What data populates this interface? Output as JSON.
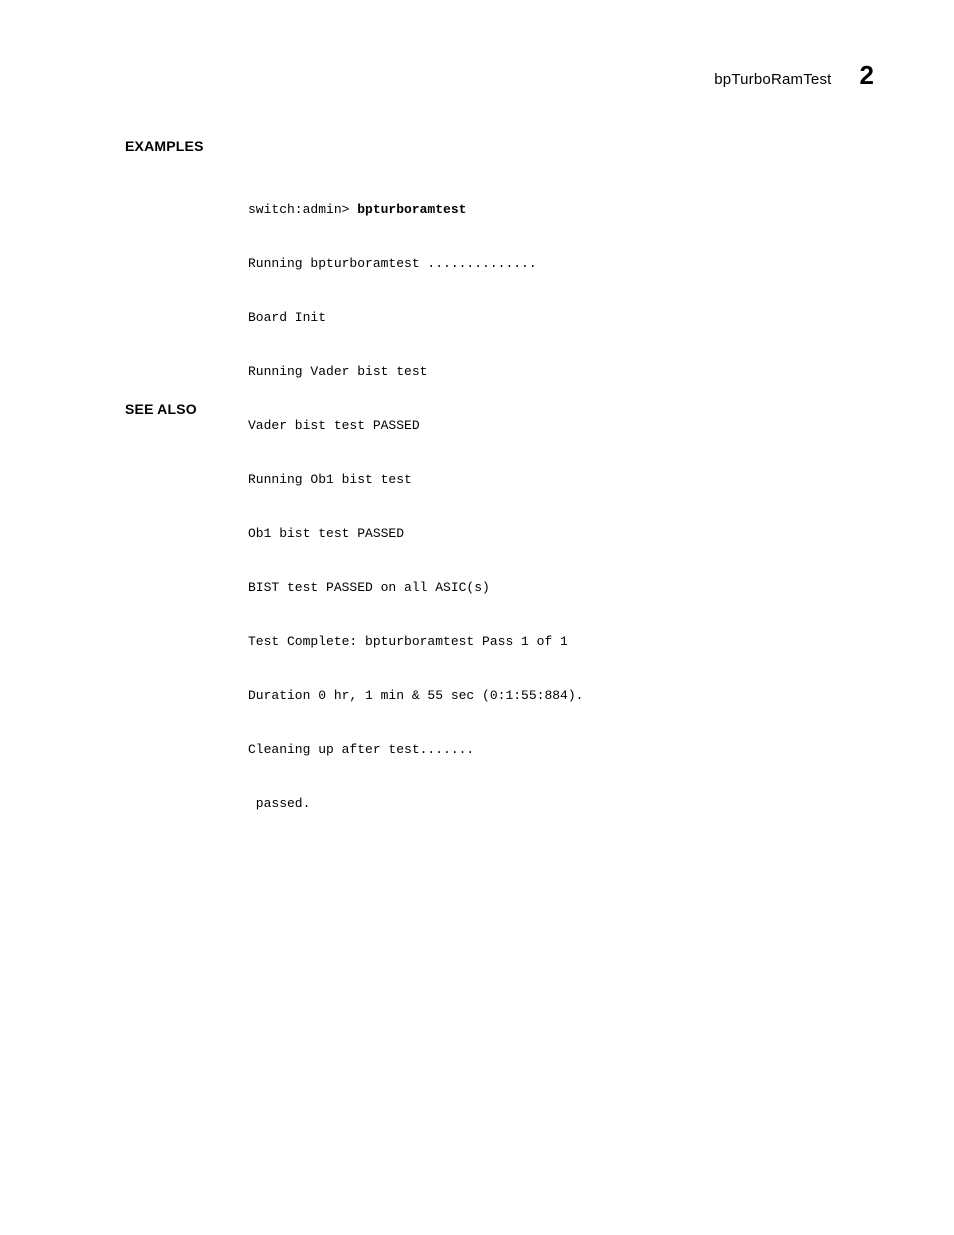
{
  "header": {
    "title": "bpTurboRamTest",
    "chapter_number": "2"
  },
  "sections": {
    "examples_label": "EXAMPLES",
    "see_also_label": "SEE ALSO"
  },
  "code": {
    "prompt": "switch:admin> ",
    "command": "bpturboramtest",
    "lines": [
      "Running bpturboramtest ..............",
      "Board Init",
      "Running Vader bist test",
      "Vader bist test PASSED",
      "Running Ob1 bist test",
      "Ob1 bist test PASSED",
      "BIST test PASSED on all ASIC(s)",
      "Test Complete: bpturboramtest Pass 1 of 1",
      "Duration 0 hr, 1 min & 55 sec (0:1:55:884).",
      "Cleaning up after test.......",
      " passed."
    ]
  }
}
